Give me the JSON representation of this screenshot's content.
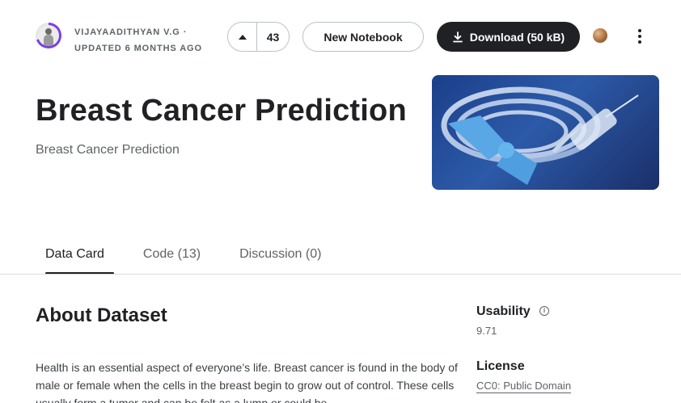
{
  "header": {
    "author": "VIJAYAADITHYAN V.G",
    "author_suffix": " ·",
    "updated": "UPDATED 6 MONTHS AGO",
    "vote_count": "43",
    "new_notebook_label": "New Notebook",
    "download_label": "Download (50 kB)"
  },
  "dataset": {
    "title": "Breast Cancer Prediction",
    "subtitle": "Breast Cancer Prediction"
  },
  "tabs": [
    {
      "label": "Data Card",
      "active": true
    },
    {
      "label": "Code (13)",
      "active": false
    },
    {
      "label": "Discussion (0)",
      "active": false
    }
  ],
  "about": {
    "heading": "About Dataset",
    "description": "Health is an essential aspect of everyone’s life. Breast cancer is found in the body of male or female when the cells in the breast begin to grow out of control. These cells usually form a tumor and can be felt as a lump or could be"
  },
  "sidebar": {
    "usability_label": "Usability",
    "usability_value": "9.71",
    "license_label": "License",
    "license_value": "CC0: Public Domain"
  },
  "colors": {
    "primary_dark": "#202124",
    "avatar_ring": "#7b3fe4",
    "medal": "#a66a3a"
  },
  "icons": [
    "upvote-icon",
    "download-icon",
    "medal-icon",
    "more-vert-icon",
    "info-icon"
  ]
}
